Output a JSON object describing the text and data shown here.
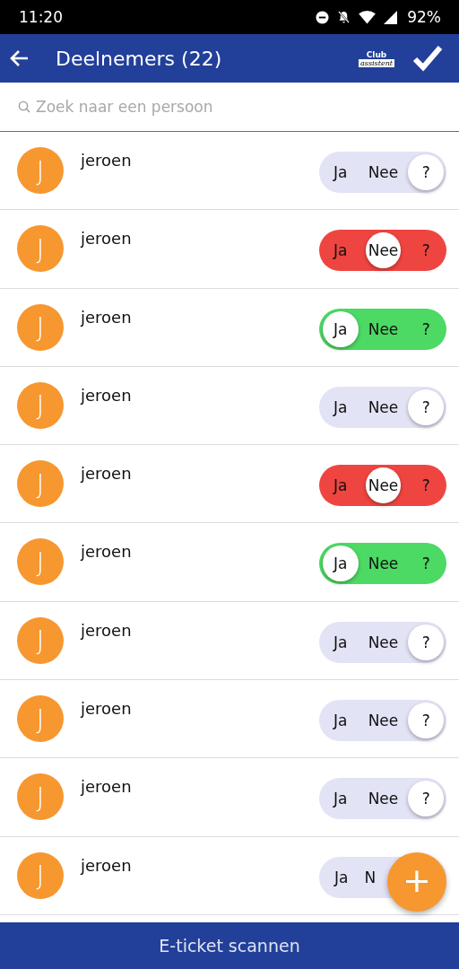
{
  "status_bar": {
    "time": "11:20",
    "battery": "92%"
  },
  "header": {
    "title": "Deelnemers (22)",
    "logo_top": "Club",
    "logo_bottom": "assistent"
  },
  "search": {
    "placeholder": "Zoek naar een persoon"
  },
  "participants": [
    {
      "initial": "J",
      "name": "jeroen",
      "options": [
        {
          "label": "Ja",
          "selected": false
        },
        {
          "label": "Nee",
          "selected": false
        },
        {
          "label": "?",
          "selected": true
        }
      ]
    },
    {
      "initial": "J",
      "name": "jeroen",
      "options": [
        {
          "label": "Ja",
          "selected": false
        },
        {
          "label": "Nee",
          "selected": true
        },
        {
          "label": "?",
          "selected": false
        }
      ]
    },
    {
      "initial": "J",
      "name": "jeroen",
      "options": [
        {
          "label": "Ja",
          "selected": true
        },
        {
          "label": "Nee",
          "selected": false
        },
        {
          "label": "?",
          "selected": false
        }
      ]
    },
    {
      "initial": "J",
      "name": "jeroen",
      "options": [
        {
          "label": "Ja",
          "selected": false
        },
        {
          "label": "Nee",
          "selected": false
        },
        {
          "label": "?",
          "selected": true
        }
      ]
    },
    {
      "initial": "J",
      "name": "jeroen",
      "options": [
        {
          "label": "Ja",
          "selected": false
        },
        {
          "label": "Nee",
          "selected": true
        },
        {
          "label": "?",
          "selected": false
        }
      ]
    },
    {
      "initial": "J",
      "name": "jeroen",
      "options": [
        {
          "label": "Ja",
          "selected": true
        },
        {
          "label": "Nee",
          "selected": false
        },
        {
          "label": "?",
          "selected": false
        }
      ]
    },
    {
      "initial": "J",
      "name": "jeroen",
      "options": [
        {
          "label": "Ja",
          "selected": false
        },
        {
          "label": "Nee",
          "selected": false
        },
        {
          "label": "?",
          "selected": true
        }
      ]
    },
    {
      "initial": "J",
      "name": "jeroen",
      "options": [
        {
          "label": "Ja",
          "selected": false
        },
        {
          "label": "Nee",
          "selected": false
        },
        {
          "label": "?",
          "selected": true
        }
      ]
    },
    {
      "initial": "J",
      "name": "jeroen",
      "options": [
        {
          "label": "Ja",
          "selected": false
        },
        {
          "label": "Nee",
          "selected": false
        },
        {
          "label": "?",
          "selected": true
        }
      ]
    },
    {
      "initial": "J",
      "name": "jeroen",
      "options": [
        {
          "label": "Ja",
          "selected": false
        },
        {
          "label": "N",
          "selected": false
        }
      ]
    }
  ],
  "fab": {
    "label": "+"
  },
  "bottom_button": {
    "label": "E-ticket scannen"
  }
}
